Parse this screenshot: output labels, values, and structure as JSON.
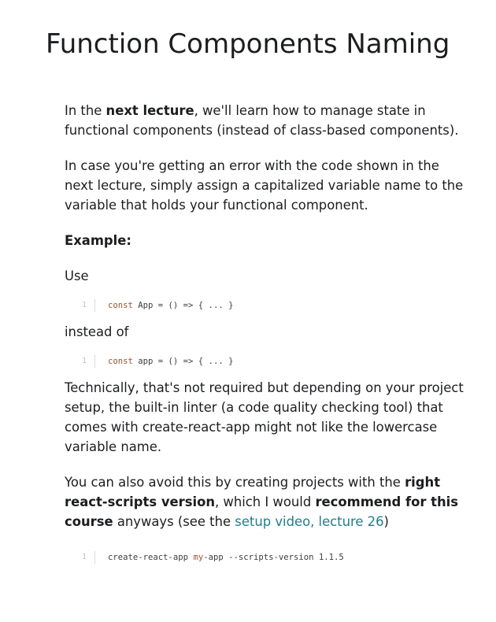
{
  "title": "Function Components Naming",
  "p1": {
    "pre": "In the ",
    "bold": "next lecture",
    "post": ", we'll learn how to manage state in functional components (instead of class-based components)."
  },
  "p2": "In case you're getting an error with the code shown in the next lecture, simply assign a capitalized variable name to the variable that holds your functional component.",
  "example_label": "Example:",
  "use_label": "Use",
  "code1": {
    "line": "1",
    "kw": "const",
    "rest": " App = () => { ... }"
  },
  "instead_label": "instead of",
  "code2": {
    "line": "1",
    "kw": "const",
    "rest": " app = () => { ... }"
  },
  "p3": "Technically, that's not required but depending on your project setup, the built-in linter (a code quality checking tool) that comes with create-react-app might not like the lowercase variable name.",
  "p4": {
    "t1": "You can also avoid this by creating projects with the ",
    "b1": "right react-scripts version",
    "t2": ", which I would ",
    "b2": "recommend for this course",
    "t3": " anyways (see the ",
    "link": "setup video, lecture 26",
    "t4": ")"
  },
  "code3": {
    "line": "1",
    "pre": "create-react-app ",
    "kw": "my",
    "rest": "-app --scripts-version 1.1.5"
  }
}
